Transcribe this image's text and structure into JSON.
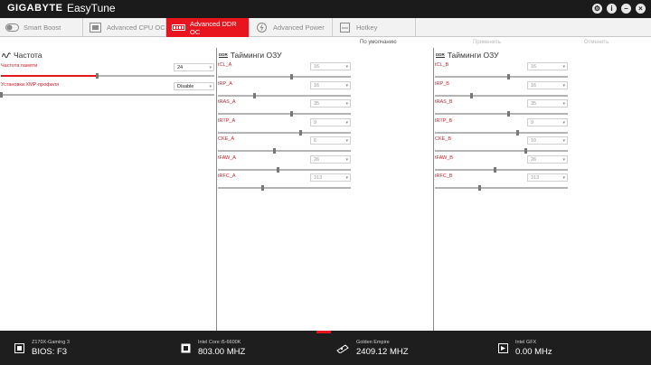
{
  "titlebar": {
    "brand": "GIGABYTE",
    "app": "EasyTune",
    "controls": [
      "gear-icon",
      "info-icon",
      "minimize-icon",
      "close-icon"
    ]
  },
  "tabs": [
    {
      "label": "Smart Boost",
      "icon": "toggle-icon",
      "active": false
    },
    {
      "label": "Advanced CPU OC",
      "icon": "cpu-icon",
      "active": false
    },
    {
      "label": "Advanced DDR OC",
      "icon": "memory-icon",
      "active": true
    },
    {
      "label": "Advanced Power",
      "icon": "power-icon",
      "active": false
    },
    {
      "label": "Hotkey",
      "icon": "keyboard-icon",
      "active": false
    }
  ],
  "subheader": {
    "default": "По умолчанию",
    "apply": "Применить",
    "cancel": "Отменить"
  },
  "freq_panel": {
    "title": "Частота",
    "mem_freq": {
      "label": "Частота памяти",
      "value": "24",
      "level": 0.45
    },
    "xmp": {
      "label": "Установки XMP-профиля",
      "value": "Disable",
      "level": 0.0
    }
  },
  "timings_a": {
    "title": "Тайминги ОЗУ",
    "ddr_tag": "DDR",
    "items": [
      {
        "label": "tCL_A",
        "value": "16",
        "level": 0.55
      },
      {
        "label": "tRP_A",
        "value": "16",
        "level": 0.27
      },
      {
        "label": "tRAS_A",
        "value": "35",
        "level": 0.55
      },
      {
        "label": "tRTP_A",
        "value": "9",
        "level": 0.62
      },
      {
        "label": "CKE_A",
        "value": "6",
        "level": 0.42
      },
      {
        "label": "tFAW_A",
        "value": "26",
        "level": 0.45
      },
      {
        "label": "tRFC_A",
        "value": "313",
        "level": 0.33
      }
    ]
  },
  "timings_b": {
    "title": "Тайминги ОЗУ",
    "ddr_tag": "DDR",
    "items": [
      {
        "label": "tCL_B",
        "value": "16",
        "level": 0.55
      },
      {
        "label": "tRP_B",
        "value": "16",
        "level": 0.27
      },
      {
        "label": "tRAS_B",
        "value": "35",
        "level": 0.55
      },
      {
        "label": "tRTP_B",
        "value": "9",
        "level": 0.62
      },
      {
        "label": "CKE_B",
        "value": "10",
        "level": 0.68
      },
      {
        "label": "tFAW_B",
        "value": "26",
        "level": 0.45
      },
      {
        "label": "tRFC_B",
        "value": "313",
        "level": 0.33
      }
    ]
  },
  "footer": {
    "board": {
      "name": "Z170X-Gaming 3",
      "value": "BIOS: F3"
    },
    "cpu": {
      "name": "Intel Core i5-6600K",
      "value": "803.00 MHZ"
    },
    "mem": {
      "name": "Golden Empire",
      "value": "2409.12 MHZ"
    },
    "gfx": {
      "name": "Intel GFX",
      "value": "0.00 MHz"
    }
  },
  "colors": {
    "accent": "#e8141e",
    "label": "#d0202a",
    "titlebar": "#1b1b1b",
    "footer": "#1e1e1e"
  }
}
